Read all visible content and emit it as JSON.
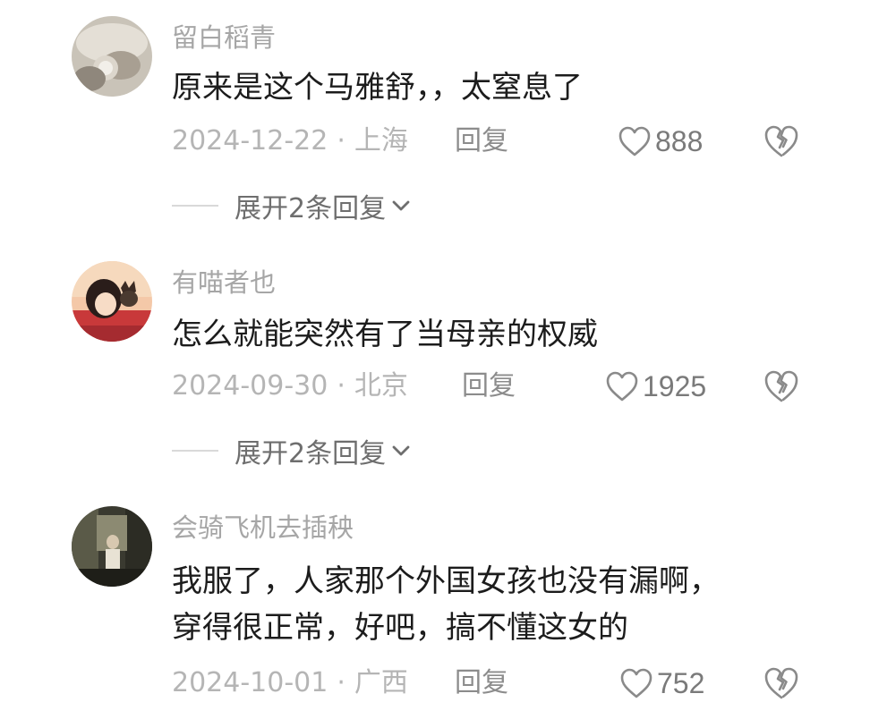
{
  "comments": [
    {
      "username": "留白稻青",
      "text_lines": [
        "原来是这个马雅舒，，太窒息了"
      ],
      "date": "2024-12-22",
      "location": "上海",
      "reply_label": "回复",
      "likes": "888",
      "expand_label": "展开2条回复"
    },
    {
      "username": "有喵者也",
      "text_lines": [
        "怎么就能突然有了当母亲的权威"
      ],
      "date": "2024-09-30",
      "location": "北京",
      "reply_label": "回复",
      "likes": "1925",
      "expand_label": "展开2条回复"
    },
    {
      "username": "会骑飞机去插秧",
      "text_lines": [
        "我服了，人家那个外国女孩也没有漏啊，",
        "穿得很正常，好吧，搞不懂这女的"
      ],
      "date": "2024-10-01",
      "location": "广西",
      "reply_label": "回复",
      "likes": "752"
    }
  ],
  "meta_separator": "·",
  "icons": {
    "like": "heart-outline-icon",
    "dislike": "broken-heart-icon",
    "expand": "chevron-down-icon"
  },
  "colors": {
    "username": "#a6a6a6",
    "meta": "#b5b5b5",
    "text": "#1c1c1c"
  }
}
